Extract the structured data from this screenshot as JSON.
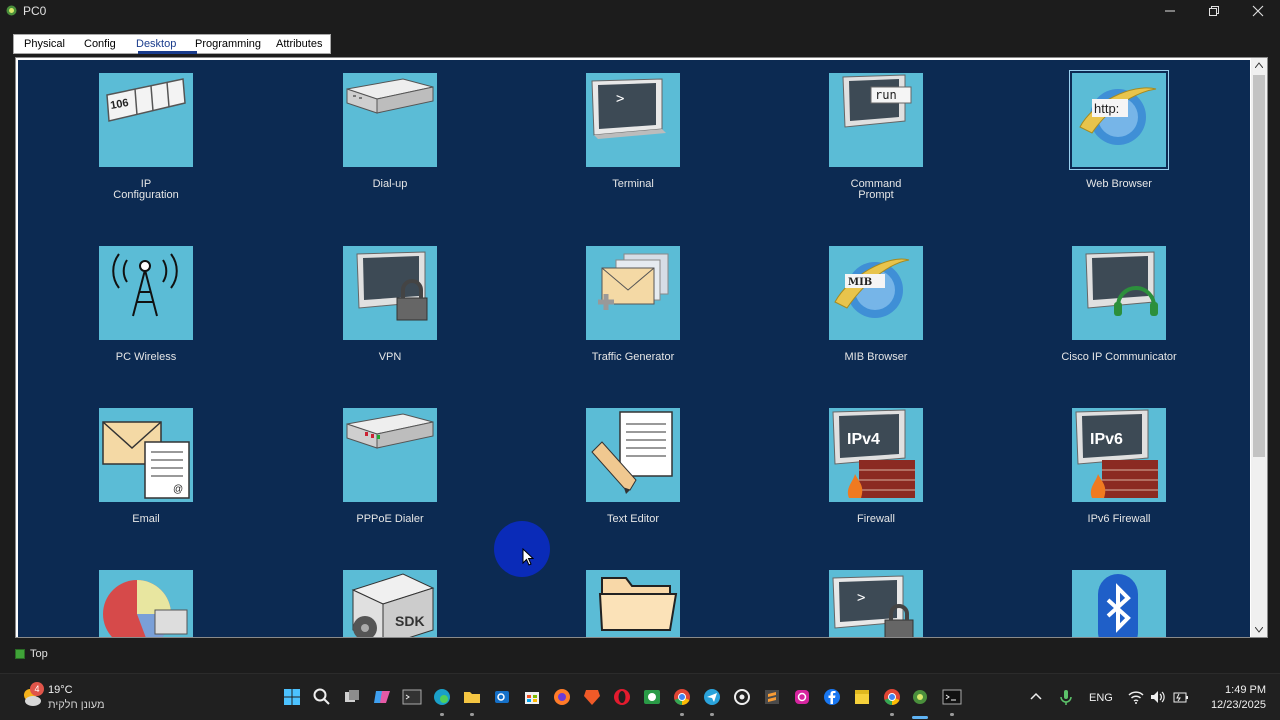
{
  "window": {
    "title": "PC0",
    "controls": [
      "minimize",
      "maximize",
      "close"
    ]
  },
  "tabs": [
    {
      "label": "Physical"
    },
    {
      "label": "Config"
    },
    {
      "label": "Desktop",
      "active": true
    },
    {
      "label": "Programming"
    },
    {
      "label": "Attributes"
    }
  ],
  "desktop": {
    "background": "#0c2a52",
    "tile_color": "#5bbcd6",
    "apps": [
      {
        "label": "IP\nConfiguration",
        "icon": "ip-config-icon"
      },
      {
        "label": "Dial-up",
        "icon": "modem-icon"
      },
      {
        "label": "Terminal",
        "icon": "terminal-icon"
      },
      {
        "label": "Command\nPrompt",
        "icon": "command-prompt-icon",
        "icon_text": "run"
      },
      {
        "label": "Web Browser",
        "icon": "web-browser-icon",
        "icon_text": "http:",
        "selected": true
      },
      {
        "label": "PC Wireless",
        "icon": "wireless-tower-icon"
      },
      {
        "label": "VPN",
        "icon": "vpn-lock-icon"
      },
      {
        "label": "Traffic Generator",
        "icon": "traffic-generator-icon"
      },
      {
        "label": "MIB Browser",
        "icon": "mib-browser-icon",
        "icon_text": "MIB"
      },
      {
        "label": "Cisco IP Communicator",
        "icon": "ip-communicator-icon"
      },
      {
        "label": "Email",
        "icon": "email-icon"
      },
      {
        "label": "PPPoE Dialer",
        "icon": "pppoe-dialer-icon"
      },
      {
        "label": "Text Editor",
        "icon": "text-editor-icon"
      },
      {
        "label": "Firewall",
        "icon": "firewall-icon",
        "icon_text": "IPv4"
      },
      {
        "label": "IPv6 Firewall",
        "icon": "ipv6-firewall-icon",
        "icon_text": "IPv6"
      },
      {
        "label": "",
        "icon": "netflow-pie-icon"
      },
      {
        "label": "",
        "icon": "sdk-icon",
        "icon_text": "SDK"
      },
      {
        "label": "",
        "icon": "folder-icon"
      },
      {
        "label": "",
        "icon": "secure-terminal-icon"
      },
      {
        "label": "",
        "icon": "bluetooth-icon"
      }
    ]
  },
  "bottom_bar": {
    "top_checkbox_label": "Top"
  },
  "taskbar": {
    "weather": {
      "badge": "4",
      "temp": "19°C",
      "desc": "מעונן חלקית"
    },
    "apps": [
      "windows-start-icon",
      "search-icon",
      "task-view-icon",
      "copilot-icon",
      "terminal-app-icon",
      "edge-icon",
      "file-explorer-icon",
      "outlook-icon",
      "store-icon",
      "firefox-icon",
      "brave-icon",
      "opera-icon",
      "whatsapp-icon",
      "chrome-icon",
      "telegram-icon",
      "chatgpt-icon",
      "sublime-icon",
      "instagram-icon",
      "facebook-icon",
      "sticky-notes-icon",
      "chrome-profile-icon",
      "packet-tracer-icon",
      "cmd-icon"
    ],
    "tray": {
      "language": "ENG"
    },
    "clock": {
      "time": "1:49 PM",
      "date": "12/23/2025"
    }
  }
}
